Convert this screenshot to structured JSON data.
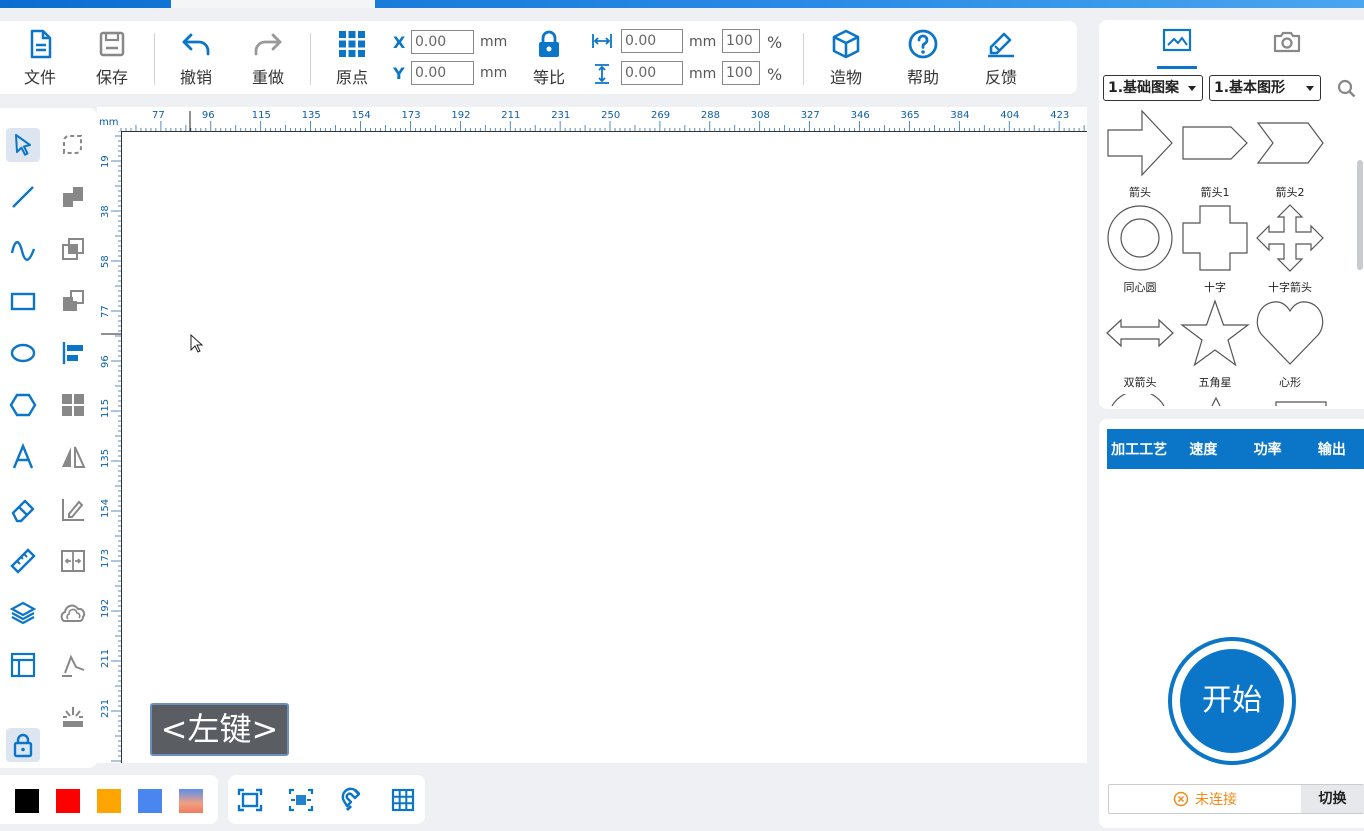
{
  "toolbar": {
    "file": "文件",
    "save": "保存",
    "undo": "撤销",
    "redo": "重做",
    "origin": "原点",
    "x_label": "X",
    "y_label": "Y",
    "x_value": "0.00",
    "y_value": "0.00",
    "unit_mm": "mm",
    "lock": "等比",
    "width_value": "0.00",
    "height_value": "0.00",
    "width_pct": "100",
    "height_pct": "100",
    "pct": "%",
    "build": "造物",
    "help": "帮助",
    "feedback": "反馈"
  },
  "ruler": {
    "unit": "mm",
    "top_ticks": [
      "77",
      "96",
      "115",
      "135",
      "154",
      "173",
      "192",
      "211",
      "231",
      "250",
      "269",
      "288",
      "308",
      "327",
      "346",
      "365",
      "384",
      "404",
      "423"
    ],
    "left_ticks": [
      "19",
      "38",
      "58",
      "77",
      "96",
      "115",
      "135",
      "154",
      "173",
      "192",
      "211",
      "231"
    ]
  },
  "key_overlay": "<左键>",
  "colors": {
    "accent": "#0b76c8",
    "swatches": [
      "#000000",
      "#ff0000",
      "#ffa500",
      "#4a86f0"
    ]
  },
  "right_panel": {
    "category1": "1.基础图案",
    "category2": "1.基本图形",
    "shapes": [
      {
        "name": "箭头",
        "icon": "arrow-shape-icon"
      },
      {
        "name": "箭头1",
        "icon": "pentagon-arrow-icon"
      },
      {
        "name": "箭头2",
        "icon": "chevron-shape-icon"
      },
      {
        "name": "同心圆",
        "icon": "concentric-circle-icon"
      },
      {
        "name": "十字",
        "icon": "cross-shape-icon"
      },
      {
        "name": "十字箭头",
        "icon": "cross-arrow-icon"
      },
      {
        "name": "双箭头",
        "icon": "double-arrow-icon"
      },
      {
        "name": "五角星",
        "icon": "star-icon"
      },
      {
        "name": "心形",
        "icon": "heart-icon"
      }
    ]
  },
  "process_table": {
    "headers": [
      "加工工艺",
      "速度",
      "功率",
      "输出"
    ]
  },
  "start_button": "开始",
  "connection": {
    "status": "未连接",
    "switch": "切换"
  }
}
